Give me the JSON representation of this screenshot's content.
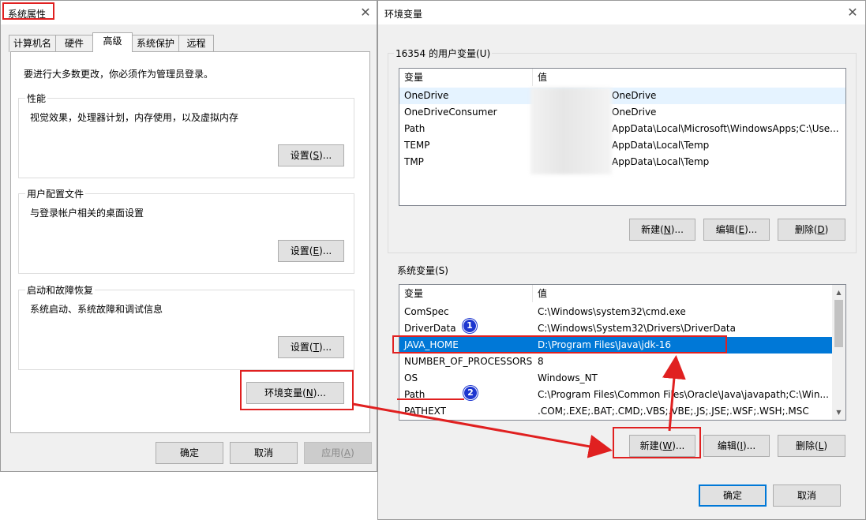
{
  "system_properties": {
    "title": "系统属性",
    "tabs": [
      {
        "label": "计算机名"
      },
      {
        "label": "硬件"
      },
      {
        "label": "高级"
      },
      {
        "label": "系统保护"
      },
      {
        "label": "远程"
      }
    ],
    "admin_note": "要进行大多数更改，你必须作为管理员登录。",
    "performance": {
      "label": "性能",
      "desc": "视觉效果，处理器计划，内存使用，以及虚拟内存",
      "button_text": "设置(",
      "button_key": "S",
      "button_tail": ")..."
    },
    "user_profiles": {
      "label": "用户配置文件",
      "desc": "与登录帐户相关的桌面设置",
      "button_text": "设置(",
      "button_key": "E",
      "button_tail": ")..."
    },
    "startup_recovery": {
      "label": "启动和故障恢复",
      "desc": "系统启动、系统故障和调试信息",
      "button_text": "设置(",
      "button_key": "T",
      "button_tail": ")..."
    },
    "env_button": {
      "text": "环境变量(",
      "key": "N",
      "tail": ")..."
    },
    "footer": {
      "ok": "确定",
      "cancel": "取消",
      "apply_text": "应用(",
      "apply_key": "A",
      "apply_tail": ")"
    }
  },
  "environment_variables": {
    "title": "环境变量",
    "user_section": {
      "label": "16354 的用户变量(U)",
      "col_var": "变量",
      "col_val": "值",
      "rows": [
        {
          "name": "OneDrive",
          "value": "OneDrive"
        },
        {
          "name": "OneDriveConsumer",
          "value": "OneDrive"
        },
        {
          "name": "Path",
          "value": "AppData\\Local\\Microsoft\\WindowsApps;C:\\Use..."
        },
        {
          "name": "TEMP",
          "value": "AppData\\Local\\Temp"
        },
        {
          "name": "TMP",
          "value": "AppData\\Local\\Temp"
        }
      ],
      "buttons": {
        "new_text": "新建(",
        "new_key": "N",
        "new_tail": ")...",
        "edit_text": "编辑(",
        "edit_key": "E",
        "edit_tail": ")...",
        "delete_text": "删除(",
        "delete_key": "D",
        "delete_tail": ")"
      }
    },
    "system_section": {
      "label": "系统变量(S)",
      "col_var": "变量",
      "col_val": "值",
      "rows": [
        {
          "name": "ComSpec",
          "value": "C:\\Windows\\system32\\cmd.exe"
        },
        {
          "name": "DriverData",
          "value": "C:\\Windows\\System32\\Drivers\\DriverData"
        },
        {
          "name": "JAVA_HOME",
          "value": "D:\\Program Files\\Java\\jdk-16",
          "selected": true
        },
        {
          "name": "NUMBER_OF_PROCESSORS",
          "value": "8"
        },
        {
          "name": "OS",
          "value": "Windows_NT"
        },
        {
          "name": "Path",
          "value": "C:\\Program Files\\Common Files\\Oracle\\Java\\javapath;C:\\Win..."
        },
        {
          "name": "PATHEXT",
          "value": ".COM;.EXE;.BAT;.CMD;.VBS;.VBE;.JS;.JSE;.WSF;.WSH;.MSC"
        }
      ],
      "buttons": {
        "new_text": "新建(",
        "new_key": "W",
        "new_tail": ")...",
        "edit_text": "编辑(",
        "edit_key": "I",
        "edit_tail": ")...",
        "delete_text": "删除(",
        "delete_key": "L",
        "delete_tail": ")"
      }
    },
    "footer": {
      "ok": "确定",
      "cancel": "取消"
    }
  },
  "annotations": {
    "badge_1": "1",
    "badge_2": "2",
    "color": "#e02020",
    "badge_color": "#1d36d0"
  },
  "colors": {
    "selection": "#0078d7",
    "dialog_bg": "#f0f0f0",
    "button_bg": "#e1e1e1"
  }
}
